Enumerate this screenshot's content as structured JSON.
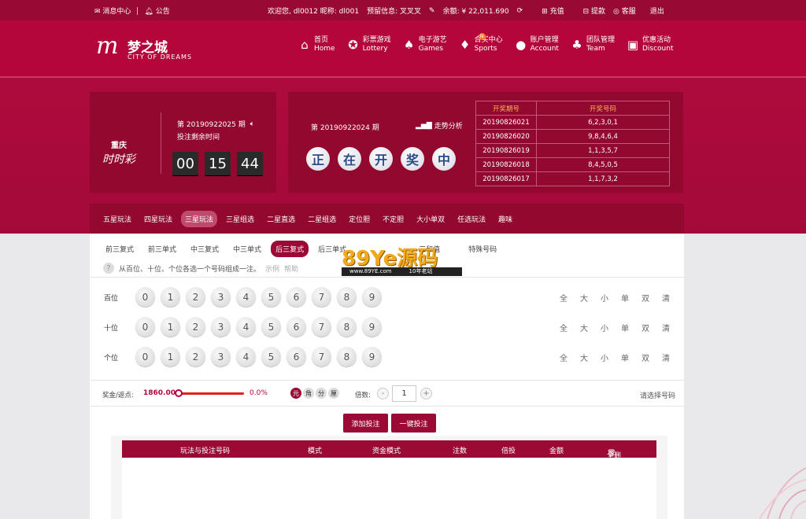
{
  "topbar": {
    "messages": "消息中心",
    "notice": "公告",
    "welcome": "欢迎您,",
    "username": "dl0012",
    "nick_label": "昵称:",
    "nickname": "dl001",
    "reserve_label": "预留信息:",
    "reserve": "叉叉叉",
    "balance_label": "余额:",
    "balance": "¥ 22,011.690",
    "recharge": "充值",
    "withdraw": "提款",
    "service": "客服",
    "logout": "退出"
  },
  "brand": {
    "mark": "m",
    "cn": "梦之城",
    "en": "CITY OF DREAMS"
  },
  "nav": [
    {
      "cn": "首页",
      "en": "Home",
      "icon": "home-icon",
      "glyph": "⌂"
    },
    {
      "cn": "彩票游戏",
      "en": "Lottery",
      "icon": "lottery-icon",
      "glyph": "✪"
    },
    {
      "cn": "电子游艺",
      "en": "Games",
      "icon": "games-icon",
      "glyph": "♠"
    },
    {
      "cn": "合买中心",
      "en": "Sports",
      "icon": "sports-icon",
      "glyph": "♦"
    },
    {
      "cn": "账户管理",
      "en": "Account",
      "icon": "account-icon",
      "glyph": "●"
    },
    {
      "cn": "团队管理",
      "en": "Team",
      "icon": "team-icon",
      "glyph": "♣"
    },
    {
      "cn": "优惠活动",
      "en": "Discount",
      "icon": "gift-icon",
      "glyph": "▣"
    }
  ],
  "sports_badge": "N",
  "current": {
    "lottery_cn": "重庆",
    "lottery_logo": "时时彩",
    "issue": "第 20190922025 期",
    "countdown_label": "投注剩余时间",
    "hh": "00",
    "mm": "15",
    "ss": "44"
  },
  "draw": {
    "issue": "第 20190922024 期",
    "trend": "走势分析",
    "status": [
      "正",
      "在",
      "开",
      "奖",
      "中"
    ]
  },
  "history": {
    "headers": [
      "开奖期号",
      "开奖号码"
    ],
    "rows": [
      [
        "20190826021",
        "6,2,3,0,1"
      ],
      [
        "20190826020",
        "9,8,4,6,4"
      ],
      [
        "20190826019",
        "1,1,3,5,7"
      ],
      [
        "20190826018",
        "8,4,5,0,5"
      ],
      [
        "20190826017",
        "1,1,7,3,2"
      ]
    ]
  },
  "play_groups": [
    "五星玩法",
    "四星玩法",
    "三星玩法",
    "三星组选",
    "二星直选",
    "二星组选",
    "定位胆",
    "不定胆",
    "大小单双",
    "任选玩法",
    "趣味"
  ],
  "play_types": [
    "前三复式",
    "前三单式",
    "中三复式",
    "中三单式",
    "后三复式",
    "后三单式"
  ],
  "play_types_hidden": [
    "三和值",
    "特殊号码"
  ],
  "tip": {
    "text": "从百位、十位、个位各选一个号码组成一注。",
    "example": "示例",
    "help": "帮助"
  },
  "watermark": {
    "big": "89Ye源码",
    "url": "www.89YE.com",
    "slogan": "10年老站"
  },
  "positions": [
    "百位",
    "十位",
    "个位"
  ],
  "digits": [
    "0",
    "1",
    "2",
    "3",
    "4",
    "5",
    "6",
    "7",
    "8",
    "9"
  ],
  "quick": [
    "全",
    "大",
    "小",
    "单",
    "双",
    "清"
  ],
  "controls": {
    "rebate_label": "奖金/返点:",
    "prize": "1860.00",
    "rebate_pct": "0.0%",
    "rebate_fraction": 0,
    "units": [
      "元",
      "角",
      "分",
      "厘"
    ],
    "multiple_label": "倍数:",
    "multiple": "1",
    "minus": "-",
    "plus": "+",
    "pick_hint": "请选择号码"
  },
  "actions": {
    "add": "添加投注",
    "one_click": "一键投注"
  },
  "order_headers": [
    "玩法与投注号码",
    "模式",
    "资金模式",
    "注数",
    "倍投",
    "金额",
    "全删"
  ],
  "colors": {
    "brand": "#b5063b",
    "dark": "#92082e",
    "topbar": "#980a33",
    "accent": "#ffb15a"
  }
}
